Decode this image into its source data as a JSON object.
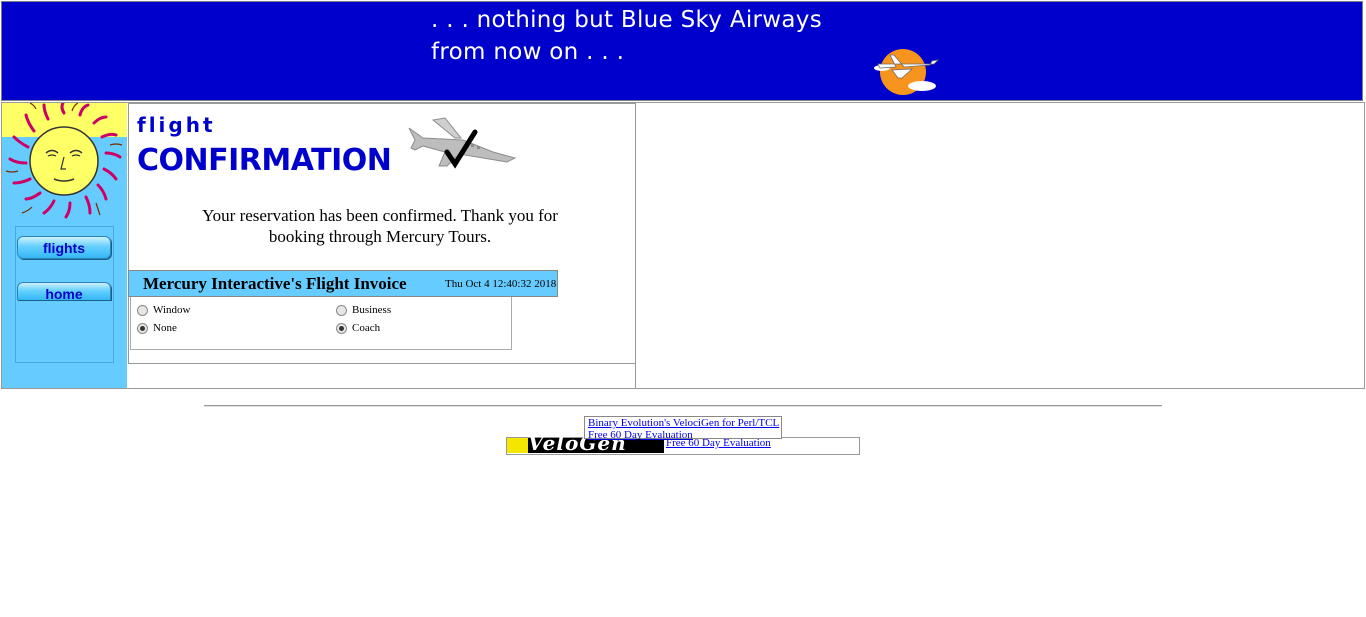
{
  "banner": {
    "slogan_line1": ". . . nothing but Blue Sky Airways",
    "slogan_line2": "from now on . . .",
    "background": "#0000cc"
  },
  "nav": {
    "flights_label": "flights",
    "home_label": "home",
    "panel_color": "#66ccff"
  },
  "confirmation": {
    "heading_small": "flight",
    "heading_big": "CONFIRMATION",
    "message": "Your reservation has been confirmed. Thank you for booking through Mercury Tours."
  },
  "invoice": {
    "title": "Mercury Interactive's Flight Invoice",
    "date": "Thu Oct 4 12:40:32 2018",
    "seat_options": [
      {
        "label": "Window",
        "checked": false
      },
      {
        "label": "None",
        "checked": true
      }
    ],
    "class_options": [
      {
        "label": "Business",
        "checked": false
      },
      {
        "label": "Coach",
        "checked": true
      }
    ]
  },
  "ad": {
    "image_text": "VeloGen",
    "link_text": "Free 60 Day Evaluation",
    "tooltip_line1": "Binary Evolution's VelociGen for Perl/TCL",
    "tooltip_line2": "Free 60 Day Evaluation"
  },
  "icons": [
    "sun-plane-logo",
    "sun-face-icon",
    "plane-checkmark-icon"
  ]
}
